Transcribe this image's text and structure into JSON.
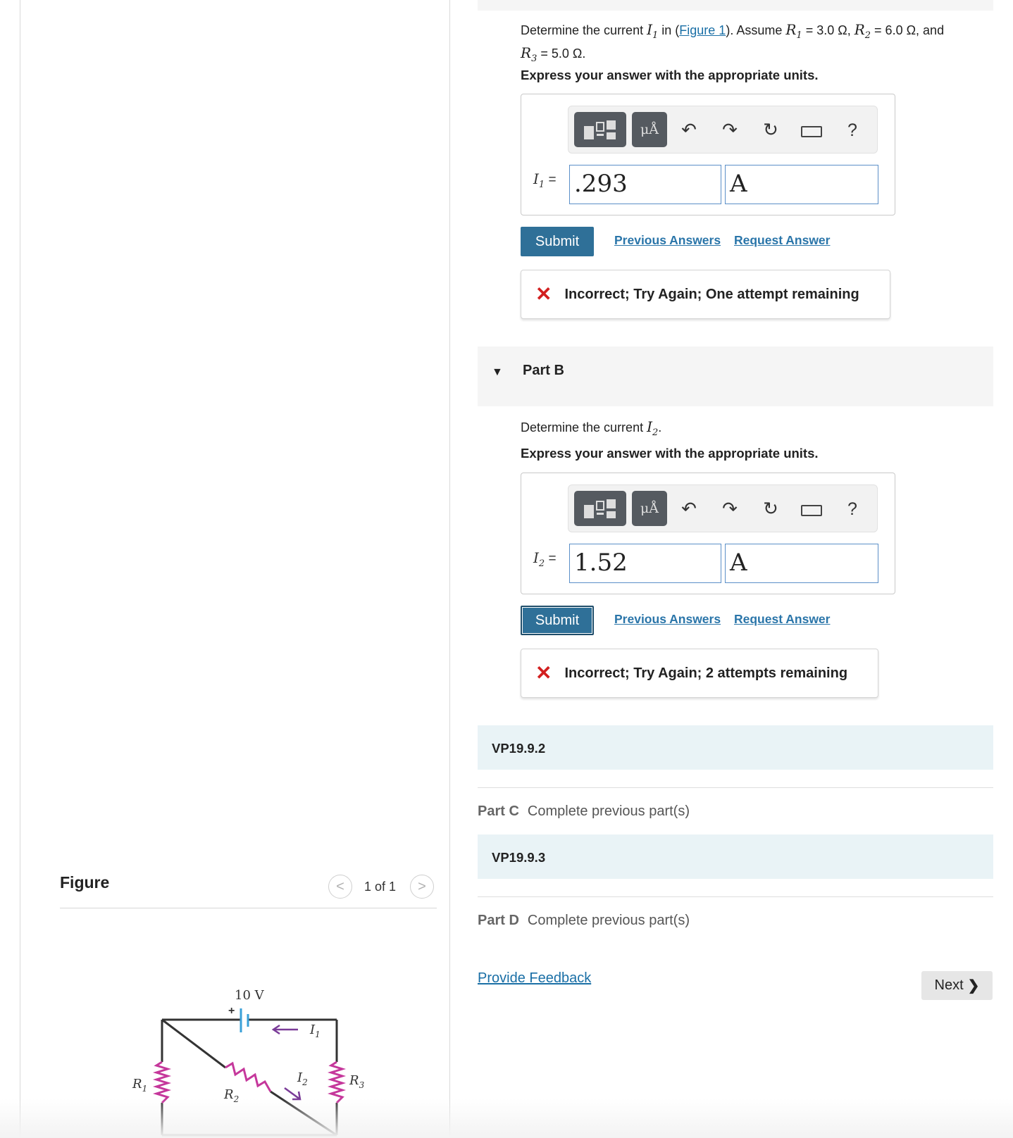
{
  "figure_panel": {
    "title": "Figure",
    "pager": "1 of 1",
    "prev_symbol": "<",
    "next_symbol": ">",
    "circuit": {
      "battery_label": "10 V",
      "plus_sign": "+",
      "r1": "R",
      "r1_sub": "1",
      "r2": "R",
      "r2_sub": "2",
      "r3": "R",
      "r3_sub": "3",
      "i1": "I",
      "i1_sub": "1",
      "i2": "I",
      "i2_sub": "2",
      "colors": {
        "resistor": "#c5379b",
        "battery": "#3aa0d8",
        "arrow": "#7a3b98",
        "wire": "#333333"
      }
    }
  },
  "part_a": {
    "prompt_pre": "Determine the current ",
    "prompt_var": "I",
    "prompt_var_sub": "1",
    "prompt_in": " in (",
    "figure_link": "Figure 1",
    "prompt_assume": "). Assume ",
    "r1": "R",
    "r1_sub": "1",
    "r1_val": " = 3.0 Ω, ",
    "r2": "R",
    "r2_sub": "2",
    "r2_val": " = 6.0 Ω, and",
    "r3": "R",
    "r3_sub": "3",
    "r3_val": " = 5.0 Ω.",
    "instruction": "Express your answer with the appropriate units.",
    "var_label": "I",
    "var_label_sub": "1",
    "equals": " =",
    "value": ".293",
    "unit": "A",
    "submit": "Submit",
    "previous_answers": "Previous Answers",
    "request_answer": "Request Answer",
    "feedback": "Incorrect; Try Again; One attempt remaining"
  },
  "part_b": {
    "title": "Part B",
    "prompt_pre": "Determine the current ",
    "prompt_var": "I",
    "prompt_var_sub": "2",
    "prompt_post": ".",
    "instruction": "Express your answer with the appropriate units.",
    "var_label": "I",
    "var_label_sub": "2",
    "equals": " =",
    "value": "1.52",
    "unit": "A",
    "submit": "Submit",
    "previous_answers": "Previous Answers",
    "request_answer": "Request Answer",
    "feedback": "Incorrect; Try Again; 2 attempts remaining"
  },
  "toolbar": {
    "units_glyph": "μÅ",
    "undo": "↶",
    "redo": "↷",
    "reset": "↻",
    "help": "?"
  },
  "vp1": "VP19.9.2",
  "part_c": {
    "label": "Part C",
    "status": "Complete previous part(s)"
  },
  "vp2": "VP19.9.3",
  "part_d": {
    "label": "Part D",
    "status": "Complete previous part(s)"
  },
  "footer": {
    "provide_feedback": "Provide Feedback",
    "next": "Next"
  }
}
